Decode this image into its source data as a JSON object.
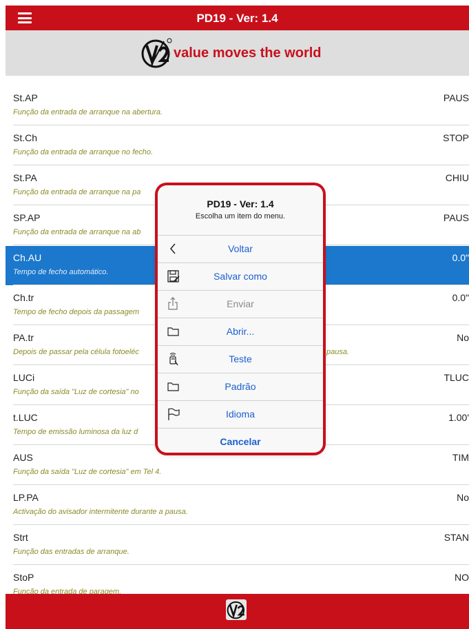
{
  "app": {
    "title": "PD19 - Ver: 1.4",
    "tagline": "value moves the world"
  },
  "list": {
    "rows": [
      {
        "code": "St.AP",
        "desc": "Função da entrada de arranque na abertura.",
        "value": "PAUS"
      },
      {
        "code": "St.Ch",
        "desc": "Função da entrada de arranque no fecho.",
        "value": "STOP"
      },
      {
        "code": "St.PA",
        "desc": "Função da entrada de arranque na pa",
        "value": "CHIU"
      },
      {
        "code": "SP.AP",
        "desc": "Função da entrada de arranque na ab",
        "value": "PAUS"
      },
      {
        "code": "Ch.AU",
        "desc": "Tempo de fecho automático.",
        "value": "0.0\"",
        "selected": true
      },
      {
        "code": "Ch.tr",
        "desc": "Tempo de fecho depois da passagem",
        "value": "0.0\""
      },
      {
        "code": "PA.tr",
        "desc": "Depois de passar pela célula fotoeléc",
        "desc_tail": "pausa.",
        "value": "No"
      },
      {
        "code": "LUCi",
        "desc": "Função da saída \"Luz de cortesia\" no",
        "value": "TLUC"
      },
      {
        "code": "t.LUC",
        "desc": "Tempo de emissão luminosa da luz d",
        "value": "1.00'"
      },
      {
        "code": "AUS",
        "desc": "Função da saída \"Luz de cortesia\" em Tel 4.",
        "value": "TIM"
      },
      {
        "code": "LP.PA",
        "desc": "Activação do avisador intermitente durante a pausa.",
        "value": "No"
      },
      {
        "code": "Strt",
        "desc": "Função das entradas de arranque.",
        "value": "STAN"
      },
      {
        "code": "StoP",
        "desc": "Função da entrada de paragem.",
        "value": "NO"
      }
    ]
  },
  "dialog": {
    "title": "PD19 - Ver: 1.4",
    "subtitle": "Escolha um item do menu.",
    "items": [
      {
        "label": "Voltar",
        "icon": "back-chevron-icon"
      },
      {
        "label": "Salvar como",
        "icon": "save-icon"
      },
      {
        "label": "Enviar",
        "icon": "share-icon",
        "disabled": true
      },
      {
        "label": "Abrir...",
        "icon": "folder-icon"
      },
      {
        "label": "Teste",
        "icon": "remote-icon"
      },
      {
        "label": "Padrão",
        "icon": "folder-icon"
      },
      {
        "label": "Idioma",
        "icon": "flag-icon"
      }
    ],
    "cancel": "Cancelar"
  },
  "colors": {
    "brand_red": "#c8101b",
    "selection_blue": "#1b78cc",
    "link_blue": "#1a5fd0",
    "desc_olive": "#8b8b2a"
  }
}
